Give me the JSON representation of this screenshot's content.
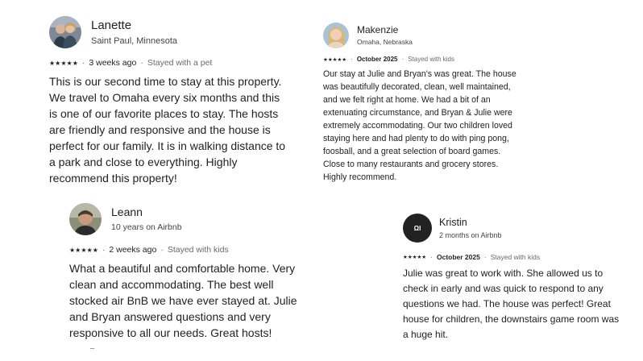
{
  "reviews": [
    {
      "name": "Lanette",
      "subtitle": "Saint Paul, Minnesota",
      "stars": "★★★★★",
      "date": "3 weeks ago",
      "stay": "Stayed with a pet",
      "text": "This is our second time to stay at this property. We travel to Omaha every six months and this is one of our favorite places to stay. The hosts are friendly and responsive and the house is perfect for our family. It is in walking distance to a park and close to everything. Highly recommend this property!"
    },
    {
      "name": "Leann",
      "subtitle": "10 years on Airbnb",
      "stars": "★★★★★",
      "date": "2 weeks ago",
      "stay": "Stayed with kids",
      "text": "What a beautiful and comfortable home. Very clean and accommodating. The best well stocked air BnB we have ever stayed at. Julie and Bryan answered questions and very responsive to all our needs. Great hosts!"
    },
    {
      "name": "Makenzie",
      "subtitle": "Omaha, Nebraska",
      "stars": "★★★★★",
      "date": "October 2025",
      "stay": "Stayed with kids",
      "text": "Our stay at Julie and Bryan's was great. The house was beautifully decorated, clean, well maintained, and we felt right at home. We had a bit of an extenuating circumstance, and Bryan & Julie were extremely accommodating. Our two children loved staying here and had plenty to do with ping pong, foosball, and a great selection of board games. Close to many restaurants and grocery stores. Highly recommend."
    },
    {
      "name": "Kristin",
      "subtitle": "2 months on Airbnb",
      "stars": "★★★★★",
      "date": "October 2025",
      "stay": "Stayed with kids",
      "avatar_text": "ΩΙ",
      "text": "Julie was great to work with.  She allowed us to check in early and was quick to respond to any questions we had.  The house was perfect! Great house for children, the downstairs game room was a huge hit."
    }
  ],
  "separator": "·",
  "colors": {
    "text": "#222222",
    "muted": "#6a6a6a",
    "avatar_dark": "#222222"
  }
}
